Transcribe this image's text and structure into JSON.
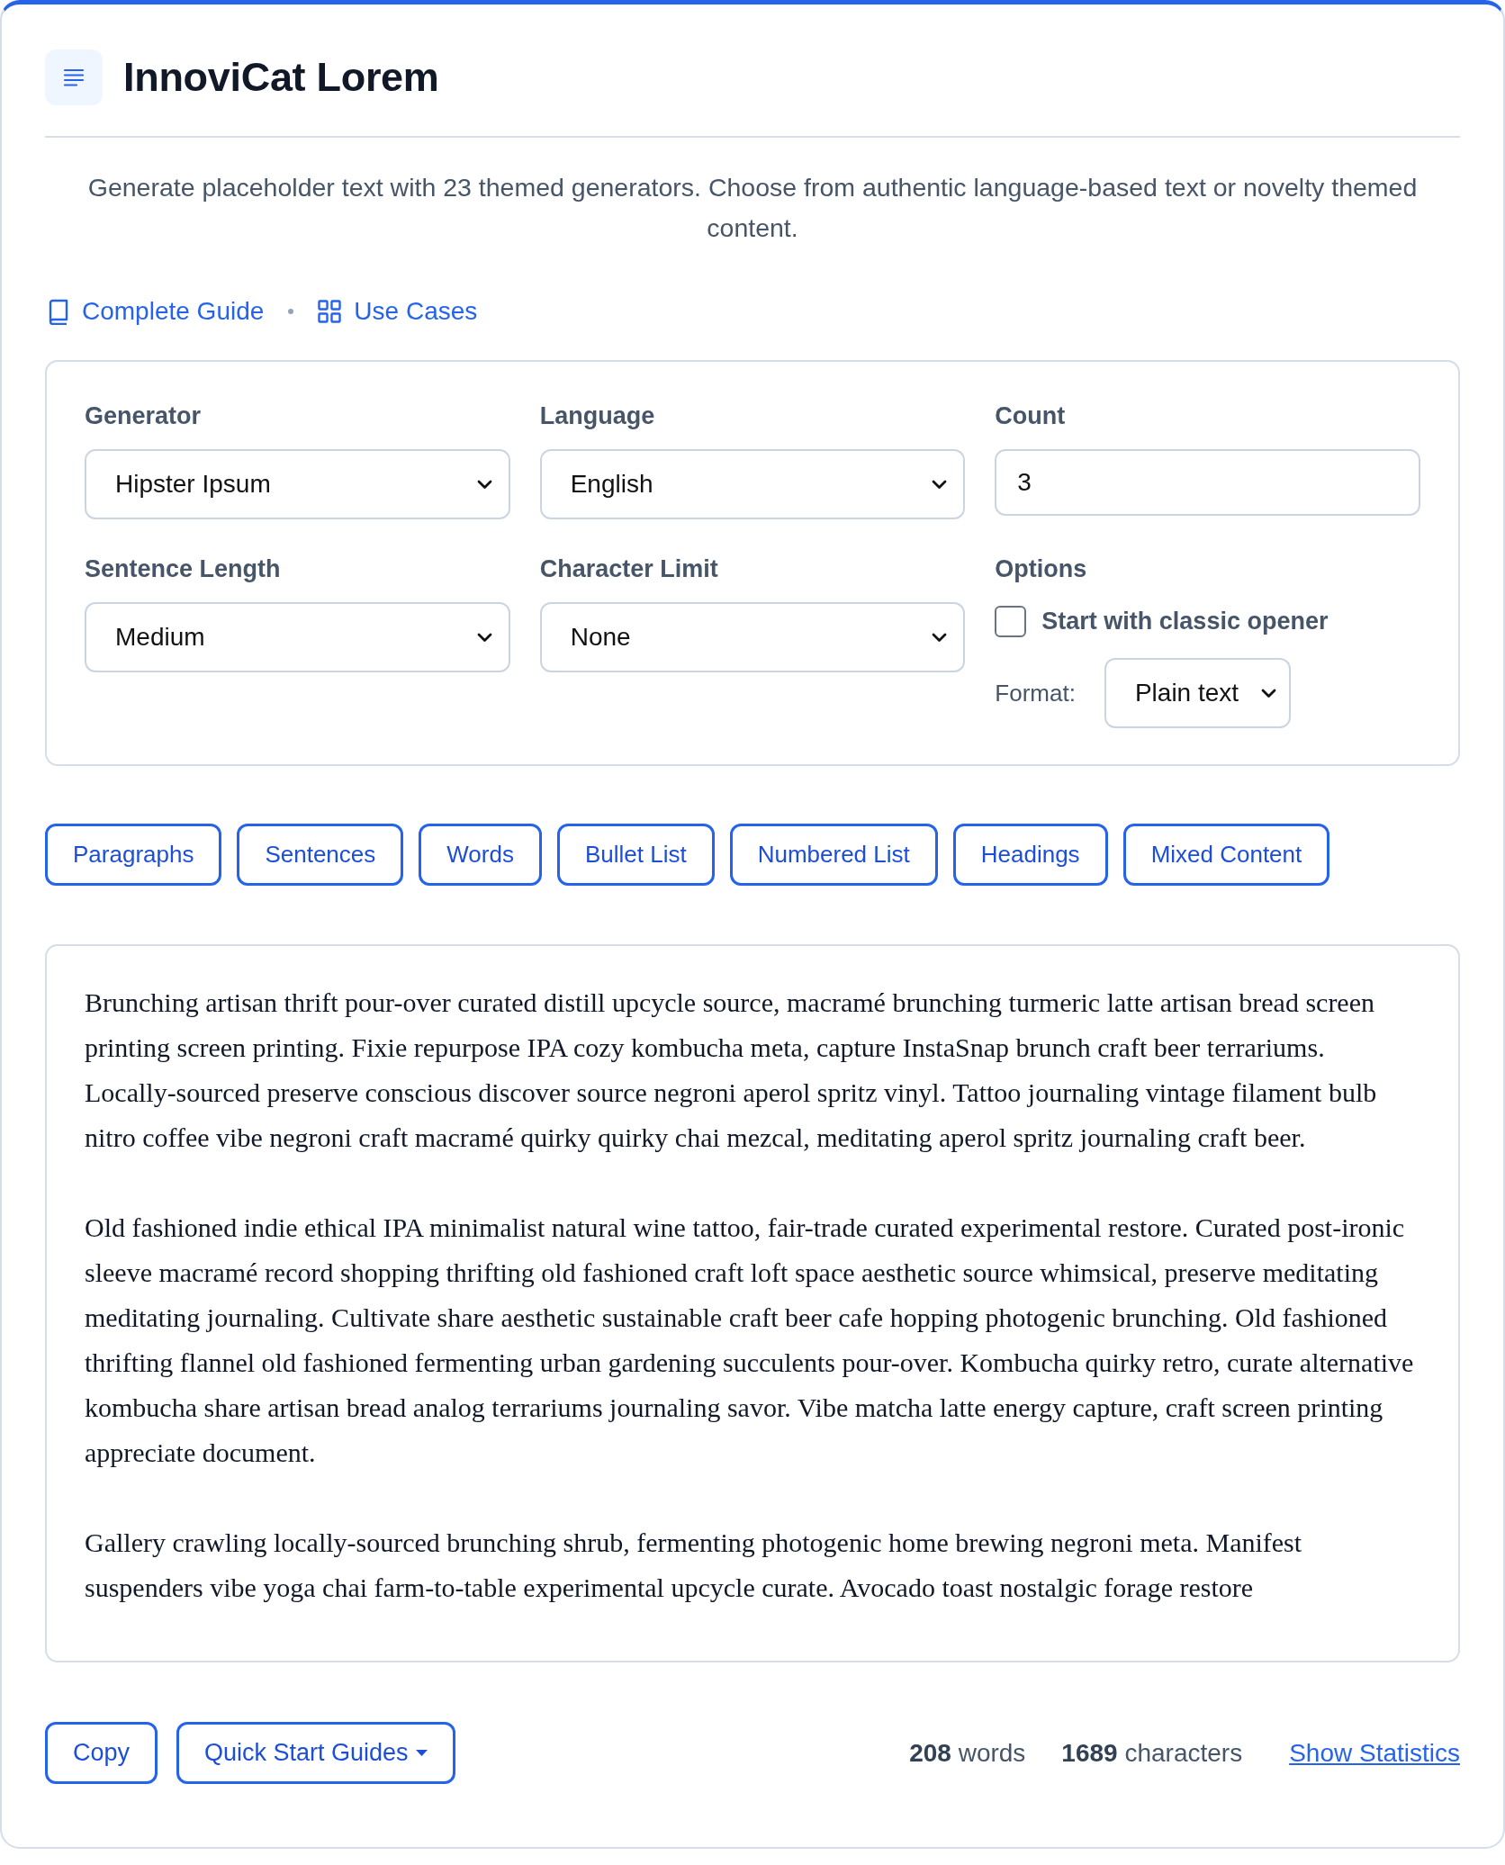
{
  "header": {
    "title": "InnoviCat Lorem"
  },
  "description": "Generate placeholder text with 23 themed generators. Choose from authentic language-based text or novelty themed content.",
  "links": [
    {
      "kind": "book",
      "label": "Complete Guide"
    },
    {
      "kind": "grid",
      "label": "Use Cases"
    }
  ],
  "settings": {
    "fields": [
      {
        "kind": "select",
        "label": "Generator",
        "value": "Hipster Ipsum"
      },
      {
        "kind": "select",
        "label": "Language",
        "value": "English"
      },
      {
        "kind": "input",
        "label": "Count",
        "value": "3"
      },
      {
        "kind": "select",
        "label": "Sentence Length",
        "value": "Medium"
      },
      {
        "kind": "select",
        "label": "Character Limit",
        "value": "None"
      },
      {
        "kind": "options",
        "label": "Options",
        "checkbox": {
          "label": "Start with classic opener",
          "checked": false
        },
        "format": {
          "label": "Format:",
          "value": "Plain text"
        }
      }
    ]
  },
  "modes": [
    {
      "label": "Paragraphs"
    },
    {
      "label": "Sentences"
    },
    {
      "label": "Words"
    },
    {
      "label": "Bullet List"
    },
    {
      "label": "Numbered List"
    },
    {
      "label": "Headings"
    },
    {
      "label": "Mixed Content"
    }
  ],
  "output": {
    "paragraphs": [
      "Brunching artisan thrift pour-over curated distill upcycle source, macramé brunching turmeric latte artisan bread screen printing screen printing. Fixie repurpose IPA cozy kombucha meta, capture InstaSnap brunch craft beer terrariums. Locally-sourced preserve conscious discover source negroni aperol spritz vinyl. Tattoo journaling vintage filament bulb nitro coffee vibe negroni craft macramé quirky quirky chai mezcal, meditating aperol spritz journaling craft beer.",
      "Old fashioned indie ethical IPA minimalist natural wine tattoo, fair-trade curated experimental restore. Curated post-ironic sleeve macramé record shopping thrifting old fashioned craft loft space aesthetic source whimsical, preserve meditating meditating journaling. Cultivate share aesthetic sustainable craft beer cafe hopping photogenic brunching. Old fashioned thrifting flannel old fashioned fermenting urban gardening succulents pour-over. Kombucha quirky retro, curate alternative kombucha share artisan bread analog terrariums journaling savor. Vibe matcha latte energy capture, craft screen printing appreciate document.",
      "Gallery crawling locally-sourced brunching shrub, fermenting photogenic home brewing negroni meta. Manifest suspenders vibe yoga chai farm-to-table experimental upcycle curate. Avocado toast nostalgic forage restore"
    ]
  },
  "footer": {
    "buttons": [
      {
        "kind": "button",
        "label": "Copy"
      },
      {
        "kind": "dropdown",
        "label": "Quick Start Guides"
      }
    ],
    "stats": [
      "**208** words",
      "**1689** characters"
    ],
    "link": "Show Statistics"
  }
}
